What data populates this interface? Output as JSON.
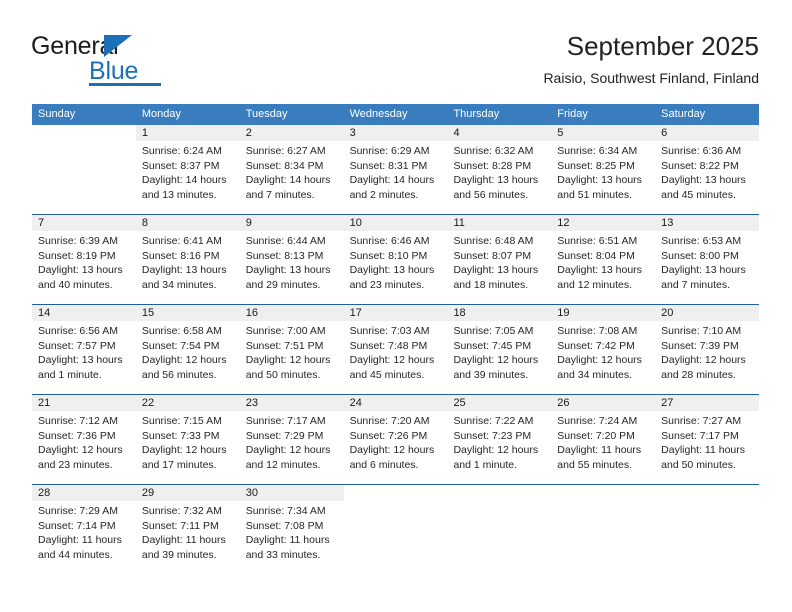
{
  "brand": {
    "name_part1": "General",
    "name_part2": "Blue",
    "accent_color": "#1b70b8",
    "triangle_icon": "triangle-icon"
  },
  "header": {
    "title": "September 2025",
    "subtitle": "Raisio, Southwest Finland, Finland"
  },
  "calendar": {
    "header_bg": "#3a7dbe",
    "row_divider_color": "#1f5fa0",
    "daynum_band_bg": "#efefef",
    "weekdays": [
      "Sunday",
      "Monday",
      "Tuesday",
      "Wednesday",
      "Thursday",
      "Friday",
      "Saturday"
    ],
    "weeks": [
      {
        "days": [
          {
            "num": "",
            "lines": []
          },
          {
            "num": "1",
            "lines": [
              "Sunrise: 6:24 AM",
              "Sunset: 8:37 PM",
              "Daylight: 14 hours",
              "and 13 minutes."
            ]
          },
          {
            "num": "2",
            "lines": [
              "Sunrise: 6:27 AM",
              "Sunset: 8:34 PM",
              "Daylight: 14 hours",
              "and 7 minutes."
            ]
          },
          {
            "num": "3",
            "lines": [
              "Sunrise: 6:29 AM",
              "Sunset: 8:31 PM",
              "Daylight: 14 hours",
              "and 2 minutes."
            ]
          },
          {
            "num": "4",
            "lines": [
              "Sunrise: 6:32 AM",
              "Sunset: 8:28 PM",
              "Daylight: 13 hours",
              "and 56 minutes."
            ]
          },
          {
            "num": "5",
            "lines": [
              "Sunrise: 6:34 AM",
              "Sunset: 8:25 PM",
              "Daylight: 13 hours",
              "and 51 minutes."
            ]
          },
          {
            "num": "6",
            "lines": [
              "Sunrise: 6:36 AM",
              "Sunset: 8:22 PM",
              "Daylight: 13 hours",
              "and 45 minutes."
            ]
          }
        ]
      },
      {
        "days": [
          {
            "num": "7",
            "lines": [
              "Sunrise: 6:39 AM",
              "Sunset: 8:19 PM",
              "Daylight: 13 hours",
              "and 40 minutes."
            ]
          },
          {
            "num": "8",
            "lines": [
              "Sunrise: 6:41 AM",
              "Sunset: 8:16 PM",
              "Daylight: 13 hours",
              "and 34 minutes."
            ]
          },
          {
            "num": "9",
            "lines": [
              "Sunrise: 6:44 AM",
              "Sunset: 8:13 PM",
              "Daylight: 13 hours",
              "and 29 minutes."
            ]
          },
          {
            "num": "10",
            "lines": [
              "Sunrise: 6:46 AM",
              "Sunset: 8:10 PM",
              "Daylight: 13 hours",
              "and 23 minutes."
            ]
          },
          {
            "num": "11",
            "lines": [
              "Sunrise: 6:48 AM",
              "Sunset: 8:07 PM",
              "Daylight: 13 hours",
              "and 18 minutes."
            ]
          },
          {
            "num": "12",
            "lines": [
              "Sunrise: 6:51 AM",
              "Sunset: 8:04 PM",
              "Daylight: 13 hours",
              "and 12 minutes."
            ]
          },
          {
            "num": "13",
            "lines": [
              "Sunrise: 6:53 AM",
              "Sunset: 8:00 PM",
              "Daylight: 13 hours",
              "and 7 minutes."
            ]
          }
        ]
      },
      {
        "days": [
          {
            "num": "14",
            "lines": [
              "Sunrise: 6:56 AM",
              "Sunset: 7:57 PM",
              "Daylight: 13 hours",
              "and 1 minute."
            ]
          },
          {
            "num": "15",
            "lines": [
              "Sunrise: 6:58 AM",
              "Sunset: 7:54 PM",
              "Daylight: 12 hours",
              "and 56 minutes."
            ]
          },
          {
            "num": "16",
            "lines": [
              "Sunrise: 7:00 AM",
              "Sunset: 7:51 PM",
              "Daylight: 12 hours",
              "and 50 minutes."
            ]
          },
          {
            "num": "17",
            "lines": [
              "Sunrise: 7:03 AM",
              "Sunset: 7:48 PM",
              "Daylight: 12 hours",
              "and 45 minutes."
            ]
          },
          {
            "num": "18",
            "lines": [
              "Sunrise: 7:05 AM",
              "Sunset: 7:45 PM",
              "Daylight: 12 hours",
              "and 39 minutes."
            ]
          },
          {
            "num": "19",
            "lines": [
              "Sunrise: 7:08 AM",
              "Sunset: 7:42 PM",
              "Daylight: 12 hours",
              "and 34 minutes."
            ]
          },
          {
            "num": "20",
            "lines": [
              "Sunrise: 7:10 AM",
              "Sunset: 7:39 PM",
              "Daylight: 12 hours",
              "and 28 minutes."
            ]
          }
        ]
      },
      {
        "days": [
          {
            "num": "21",
            "lines": [
              "Sunrise: 7:12 AM",
              "Sunset: 7:36 PM",
              "Daylight: 12 hours",
              "and 23 minutes."
            ]
          },
          {
            "num": "22",
            "lines": [
              "Sunrise: 7:15 AM",
              "Sunset: 7:33 PM",
              "Daylight: 12 hours",
              "and 17 minutes."
            ]
          },
          {
            "num": "23",
            "lines": [
              "Sunrise: 7:17 AM",
              "Sunset: 7:29 PM",
              "Daylight: 12 hours",
              "and 12 minutes."
            ]
          },
          {
            "num": "24",
            "lines": [
              "Sunrise: 7:20 AM",
              "Sunset: 7:26 PM",
              "Daylight: 12 hours",
              "and 6 minutes."
            ]
          },
          {
            "num": "25",
            "lines": [
              "Sunrise: 7:22 AM",
              "Sunset: 7:23 PM",
              "Daylight: 12 hours",
              "and 1 minute."
            ]
          },
          {
            "num": "26",
            "lines": [
              "Sunrise: 7:24 AM",
              "Sunset: 7:20 PM",
              "Daylight: 11 hours",
              "and 55 minutes."
            ]
          },
          {
            "num": "27",
            "lines": [
              "Sunrise: 7:27 AM",
              "Sunset: 7:17 PM",
              "Daylight: 11 hours",
              "and 50 minutes."
            ]
          }
        ]
      },
      {
        "days": [
          {
            "num": "28",
            "lines": [
              "Sunrise: 7:29 AM",
              "Sunset: 7:14 PM",
              "Daylight: 11 hours",
              "and 44 minutes."
            ]
          },
          {
            "num": "29",
            "lines": [
              "Sunrise: 7:32 AM",
              "Sunset: 7:11 PM",
              "Daylight: 11 hours",
              "and 39 minutes."
            ]
          },
          {
            "num": "30",
            "lines": [
              "Sunrise: 7:34 AM",
              "Sunset: 7:08 PM",
              "Daylight: 11 hours",
              "and 33 minutes."
            ]
          },
          {
            "num": "",
            "lines": []
          },
          {
            "num": "",
            "lines": []
          },
          {
            "num": "",
            "lines": []
          },
          {
            "num": "",
            "lines": []
          }
        ]
      }
    ]
  }
}
